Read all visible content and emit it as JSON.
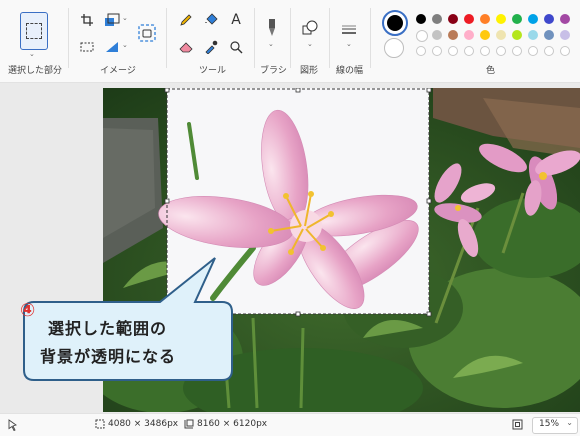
{
  "toolbar": {
    "selection_label": "選択した部分",
    "image_label": "イメージ",
    "tools_label": "ツール",
    "brush_label": "ブラシ",
    "shapes_label": "図形",
    "line_width_label": "線の幅",
    "colors_label": "色",
    "text_tool_glyph": "A"
  },
  "colors": {
    "primary": "#000000",
    "secondary": "#ffffff",
    "palette_row1": [
      "#000000",
      "#7f7f7f",
      "#880015",
      "#ed1c24",
      "#ff7f27",
      "#fff200",
      "#22b14c",
      "#00a2e8",
      "#3f48cc",
      "#a349a4"
    ],
    "palette_row2": [
      "#ffffff",
      "#c3c3c3",
      "#b97a57",
      "#ffaec9",
      "#ffc90e",
      "#efe4b0",
      "#b5e61d",
      "#99d9ea",
      "#7092be",
      "#c8bfe7"
    ]
  },
  "callout": {
    "step": "④",
    "line1": "選択した範囲の",
    "line2": "背景が透明になる"
  },
  "status": {
    "image_size": "4080 × 3486px",
    "selection_size": "8160 × 6120px",
    "zoom": "15%"
  }
}
